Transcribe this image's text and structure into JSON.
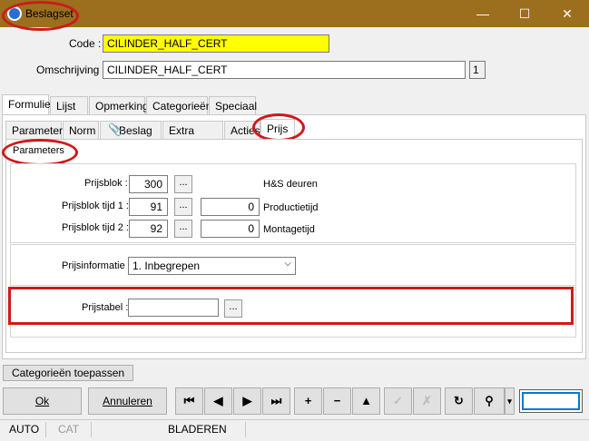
{
  "window": {
    "title": "Beslagset",
    "min": "—",
    "max": "☐",
    "close": "✕"
  },
  "fields": {
    "code_label": "Code :",
    "code_value": "CILINDER_HALF_CERT",
    "omschrijving_label": "Omschrijving :",
    "omschrijving_value": "CILINDER_HALF_CERT",
    "count": "1"
  },
  "main_tabs": [
    "Formulier",
    "Lijst",
    "Opmerking",
    "Categorieën",
    "Speciaal"
  ],
  "sub_tabs": [
    "Parameters",
    "Norm",
    "Beslag",
    "Extra profiel",
    "Acties",
    "Prijs"
  ],
  "inner_tab": "Parameters",
  "prijs": {
    "prijsblok_label": "Prijsblok :",
    "prijsblok_value": "300",
    "hs_label": "H&S deuren",
    "tijd1_label": "Prijsblok tijd 1 :",
    "tijd1_value": "91",
    "productietijd_value": "0",
    "productietijd_label": "Productietijd",
    "tijd2_label": "Prijsblok tijd 2 :",
    "tijd2_value": "92",
    "montagetijd_value": "0",
    "montagetijd_label": "Montagetijd",
    "info_label": "Prijsinformatie :",
    "info_value": "1.  Inbegrepen",
    "tabel_label": "Prijstabel :",
    "tabel_value": "",
    "dots": "..."
  },
  "buttons": {
    "categorieen": "Categorieën toepassen",
    "ok": "Ok",
    "annuleren": "Annuleren"
  },
  "nav_icons": [
    "⏮",
    "◀",
    "▶",
    "⏭",
    "+",
    "−",
    "▲",
    "✓",
    "✗",
    "↻",
    "⚲",
    "▾"
  ],
  "status": {
    "auto": "AUTO",
    "cat": "CAT",
    "mode": "BLADEREN"
  }
}
